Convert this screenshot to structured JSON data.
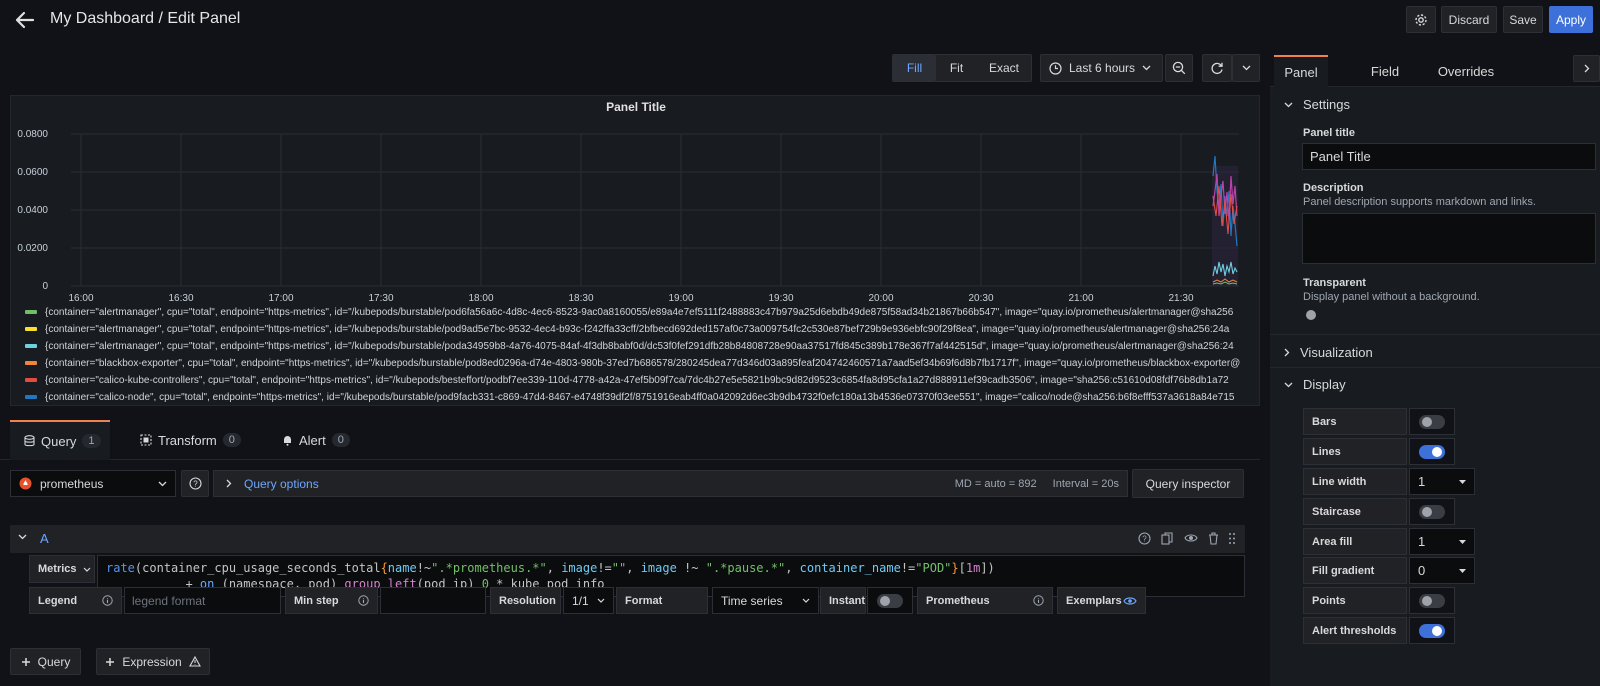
{
  "header": {
    "title": "My Dashboard / Edit Panel",
    "discard": "Discard",
    "save": "Save",
    "apply": "Apply"
  },
  "toolbar": {
    "fill": "Fill",
    "fit": "Fit",
    "exact": "Exact",
    "time_range": "Last 6 hours"
  },
  "chart": {
    "title": "Panel Title",
    "y_ticks": [
      "0.0800",
      "0.0600",
      "0.0400",
      "0.0200",
      "0"
    ],
    "x_ticks": [
      "16:00",
      "16:30",
      "17:00",
      "17:30",
      "18:00",
      "18:30",
      "19:00",
      "19:30",
      "20:00",
      "20:30",
      "21:00",
      "21:30"
    ],
    "legend": [
      {
        "color": "#73bf69",
        "text": "{container=\"alertmanager\", cpu=\"total\", endpoint=\"https-metrics\", id=\"/kubepods/burstable/pod6fa56a6c-4d8c-4ec6-8523-9ac0a8160055/e89a4e7ef5111f2488883c47b979a25d6ebdb49de875f58ad34b21867b66b547\", image=\"quay.io/prometheus/alertmanager@sha256"
      },
      {
        "color": "#fade2a",
        "text": "{container=\"alertmanager\", cpu=\"total\", endpoint=\"https-metrics\", id=\"/kubepods/burstable/pod9ad5e7bc-9532-4ec4-b93c-f242ffa33cff/2bfbecd692ded157af0c73a009754fc2c530e87bef729b9e936ebfc90f29f8ea\", image=\"quay.io/prometheus/alertmanager@sha256:24a"
      },
      {
        "color": "#6ed0e0",
        "text": "{container=\"alertmanager\", cpu=\"total\", endpoint=\"https-metrics\", id=\"/kubepods/burstable/poda34959b8-4a76-4075-84af-4f3db8babf0d/dc53f0fef291dfb28b84808728e90aa37517fd845c389b178e367f7af442515d\", image=\"quay.io/prometheus/alertmanager@sha256:24"
      },
      {
        "color": "#ef843c",
        "text": "{container=\"blackbox-exporter\", cpu=\"total\", endpoint=\"https-metrics\", id=\"/kubepods/burstable/pod8ed0296a-d74e-4803-980b-37ed7b686578/280245dea77d346d03a895feaf204742460571a7aad5ef34b69f6d8b7fb1717f\", image=\"quay.io/prometheus/blackbox-exporter@"
      },
      {
        "color": "#e24d42",
        "text": "{container=\"calico-kube-controllers\", cpu=\"total\", endpoint=\"https-metrics\", id=\"/kubepods/besteffort/podbf7ee339-110d-4778-a42a-47ef5b09f7ca/7dc4b27e5e5821b9bc9d82d9523c6854fa8d95cfa1a27d888911ef39cadb3506\", image=\"sha256:c51610d08fdf76b8db1a72"
      },
      {
        "color": "#1f78c1",
        "text": "{container=\"calico-node\", cpu=\"total\", endpoint=\"https-metrics\", id=\"/kubepods/burstable/pod9facb331-c869-47d4-8467-e4748f39df2f/8751916eab4ff0a042092d6ec3b9db4732f0efc180a13b4536e07370f03ee551\", image=\"calico/node@sha256:b6f8efff537a3618a84e715"
      }
    ]
  },
  "tabs": {
    "query": {
      "label": "Query",
      "count": "1"
    },
    "transform": {
      "label": "Transform",
      "count": "0"
    },
    "alert": {
      "label": "Alert",
      "count": "0"
    }
  },
  "query": {
    "datasource": "prometheus",
    "options_label": "Query options",
    "md": "MD = auto = 892",
    "interval": "Interval = 20s",
    "inspector": "Query inspector",
    "ref_id": "A",
    "metrics_label": "Metrics",
    "legend_label": "Legend",
    "legend_placeholder": "legend format",
    "minstep_label": "Min step",
    "resolution_label": "Resolution",
    "resolution_value": "1/1",
    "format_label": "Format",
    "format_value": "Time series",
    "instant_label": "Instant",
    "prometheus_label": "Prometheus",
    "exemplars_label": "Exemplars",
    "add_query": "Query",
    "add_expression": "Expression"
  },
  "sidebar": {
    "tabs": [
      "Panel",
      "Field",
      "Overrides"
    ],
    "settings": "Settings",
    "panel_title_label": "Panel title",
    "panel_title_value": "Panel Title",
    "description_label": "Description",
    "description_hint": "Panel description supports markdown and links.",
    "transparent_label": "Transparent",
    "transparent_hint": "Display panel without a background.",
    "visualization": "Visualization",
    "display": "Display",
    "options": [
      {
        "label": "Bars",
        "kind": "toggle",
        "on": false
      },
      {
        "label": "Lines",
        "kind": "toggle",
        "on": true
      },
      {
        "label": "Line width",
        "kind": "select",
        "value": "1"
      },
      {
        "label": "Staircase",
        "kind": "toggle",
        "on": false
      },
      {
        "label": "Area fill",
        "kind": "select",
        "value": "1"
      },
      {
        "label": "Fill gradient",
        "kind": "select",
        "value": "0"
      },
      {
        "label": "Points",
        "kind": "toggle",
        "on": false
      },
      {
        "label": "Alert thresholds",
        "kind": "toggle",
        "on": true
      }
    ]
  },
  "colors": {
    "accent": "#3d71d9",
    "background": "#111217",
    "panel": "#181b1f"
  }
}
